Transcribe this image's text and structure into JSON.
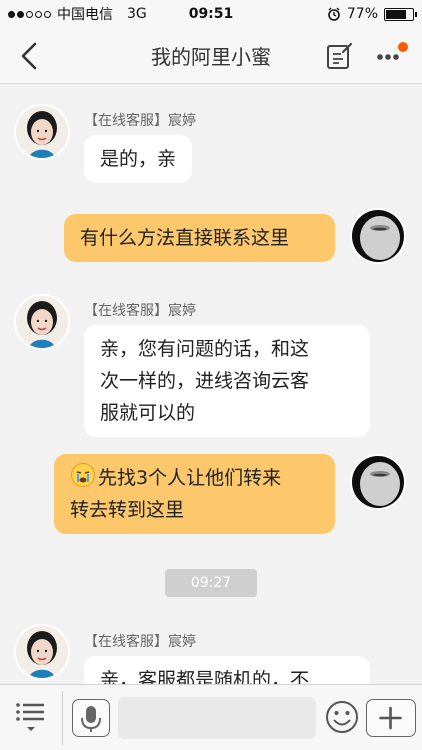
{
  "status_bar": {
    "carrier": "中国电信",
    "network": "3G",
    "time": "09:51",
    "battery_percent": "77%",
    "battery_level": 0.77,
    "icons": [
      "signal-dots-icon",
      "alarm-icon",
      "battery-icon"
    ]
  },
  "nav": {
    "title": "我的阿里小蜜",
    "icons": [
      "back-chevron-icon",
      "edit-note-icon",
      "more-dots-icon"
    ],
    "notification_dot_color": "#ff5a00"
  },
  "messages": [
    {
      "side": "left",
      "sender": "【在线客服】宸婷",
      "text_lines": [
        "是的，亲"
      ]
    },
    {
      "side": "right",
      "text_lines": [
        "有什么方法直接联系这里"
      ]
    },
    {
      "side": "left",
      "sender": "【在线客服】宸婷",
      "text_lines": [
        "亲，您有问题的话，和这",
        "次一样的，进线咨询云客",
        "服就可以的"
      ]
    },
    {
      "side": "right",
      "emoji": "crying-face-icon",
      "text_lines": [
        "先找3个人让他们转来",
        "转去转到这里"
      ]
    },
    {
      "timestamp": "09:27"
    },
    {
      "side": "left",
      "sender": "【在线客服】宸婷",
      "text_lines": [
        "亲，客服都是随机的，不"
      ]
    }
  ],
  "toolbar": {
    "input_value": "",
    "icons": [
      "menu-list-icon",
      "microphone-icon",
      "emoji-smile-icon",
      "plus-icon"
    ]
  },
  "colors": {
    "bubble_user": "#fcc86b",
    "bubble_agent": "#ffffff",
    "background": "#f2f2f2",
    "timestamp_bg": "#cfcfcf"
  }
}
